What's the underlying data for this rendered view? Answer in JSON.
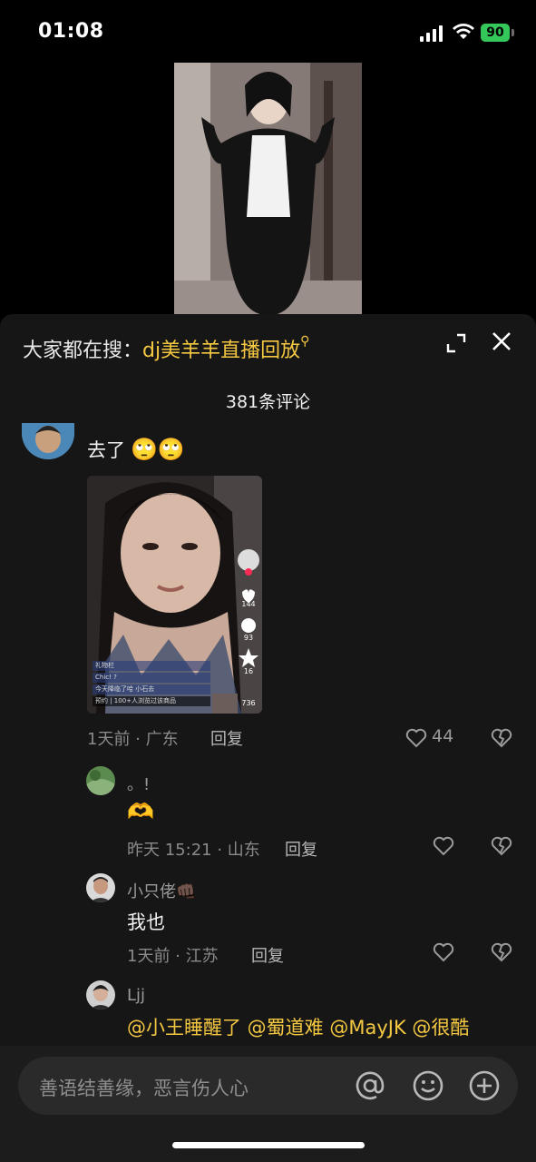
{
  "status": {
    "time": "01:08",
    "battery": "90"
  },
  "sheet": {
    "search_prefix": "大家都在搜：",
    "search_keyword": "dj美羊羊直播回放",
    "comment_count": "381条评论"
  },
  "comments": [
    {
      "text": "去了",
      "emoji": "🙄🙄",
      "image_overlay": {
        "side_counts": [
          "144",
          "93",
          "16",
          "736"
        ],
        "live_lines": [
          "礼物栏",
          "Chic! ?",
          "今天降临了哈 小石去",
          "预约 | 100+人浏览过该商品"
        ]
      },
      "meta": "1天前 · 广东",
      "reply_label": "回复",
      "likes": "44",
      "replies": [
        {
          "name": "。!",
          "text": "🫶",
          "meta": "昨天 15:21 · 山东",
          "reply_label": "回复"
        },
        {
          "name": "小只佬",
          "name_emoji": "👊🏿",
          "text": "我也",
          "meta": "1天前 · 江苏",
          "reply_label": "回复"
        },
        {
          "name": "Ljj",
          "mentions": "@小王睡醒了 @蜀道难 @MayJK @很酷"
        }
      ]
    }
  ],
  "input": {
    "placeholder": "善语结善缘，恶言伤人心"
  },
  "colors": {
    "accent": "#f5c842",
    "sheet_bg": "#161616",
    "battery_green": "#34c759"
  },
  "icons": [
    "signal-icon",
    "wifi-icon",
    "battery-icon",
    "expand-icon",
    "close-icon",
    "search-icon",
    "heart-icon",
    "broken-heart-icon",
    "at-icon",
    "emoji-icon",
    "add-icon"
  ]
}
